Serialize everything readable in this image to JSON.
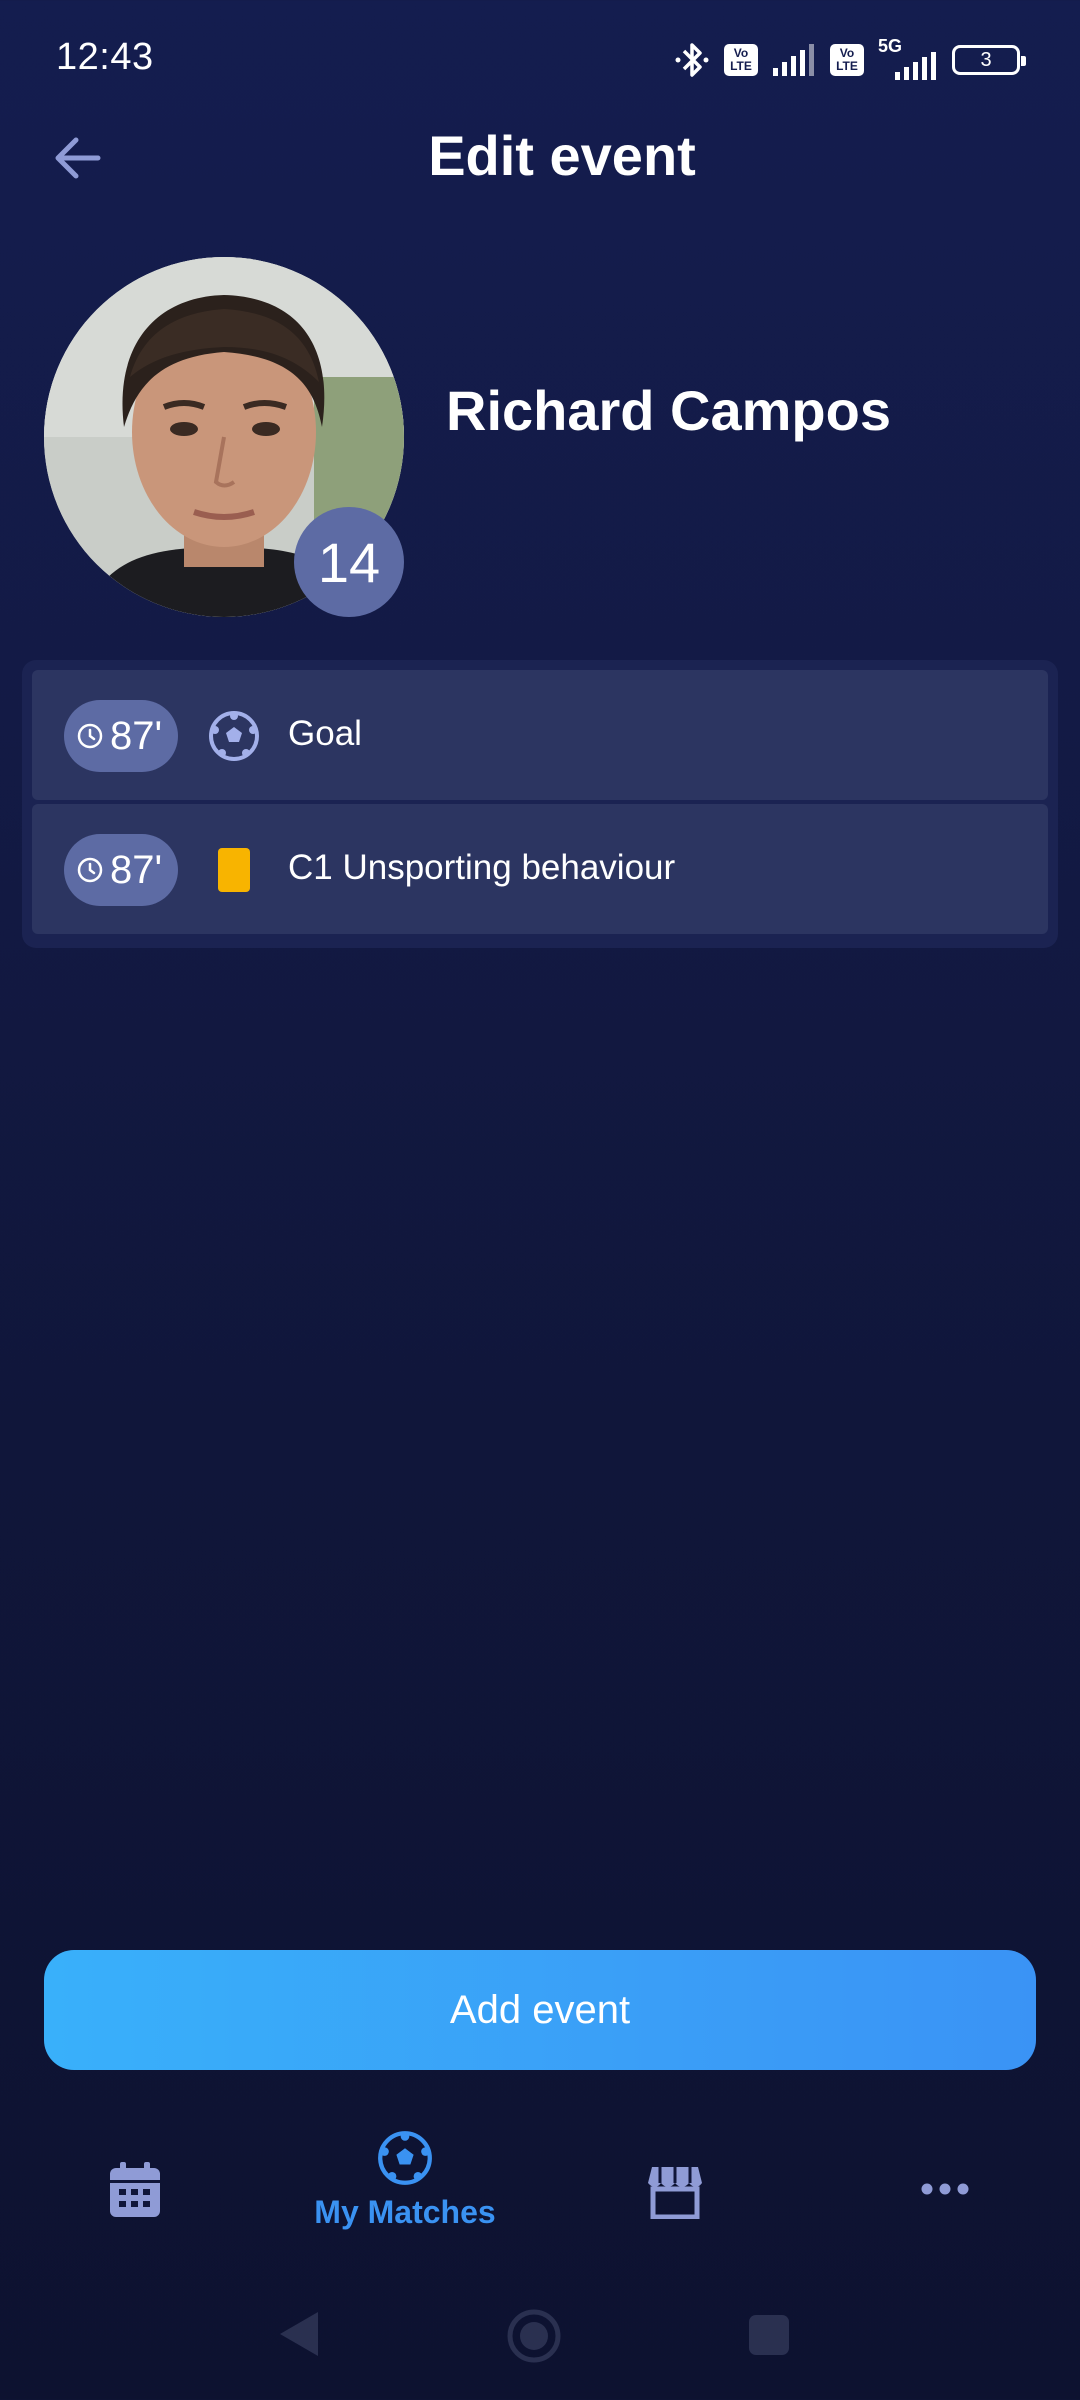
{
  "status_bar": {
    "time": "12:43",
    "signal_label": "5G",
    "lte_badge": "Vo LTE",
    "battery": "3"
  },
  "header": {
    "title": "Edit event",
    "back_icon": "arrow-left-icon"
  },
  "player": {
    "name": "Richard Campos",
    "number": "14"
  },
  "events": [
    {
      "time": "87'",
      "type": "goal",
      "icon": "soccer-ball-icon",
      "label": "Goal"
    },
    {
      "time": "87'",
      "type": "yellow-card",
      "icon": "yellow-card-icon",
      "label": "C1 Unsporting behaviour"
    }
  ],
  "add_button": {
    "label": "Add event"
  },
  "bottom_nav": {
    "items": [
      {
        "icon": "calendar-icon",
        "label": ""
      },
      {
        "icon": "soccer-ball-icon",
        "label": "My Matches",
        "active": true
      },
      {
        "icon": "store-icon",
        "label": ""
      },
      {
        "icon": "more-icon",
        "label": ""
      }
    ]
  },
  "colors": {
    "accent": "#3a92f2",
    "badge": "#5d6ba4",
    "card_row": "#2c3561",
    "yellow_card": "#f8b400"
  }
}
